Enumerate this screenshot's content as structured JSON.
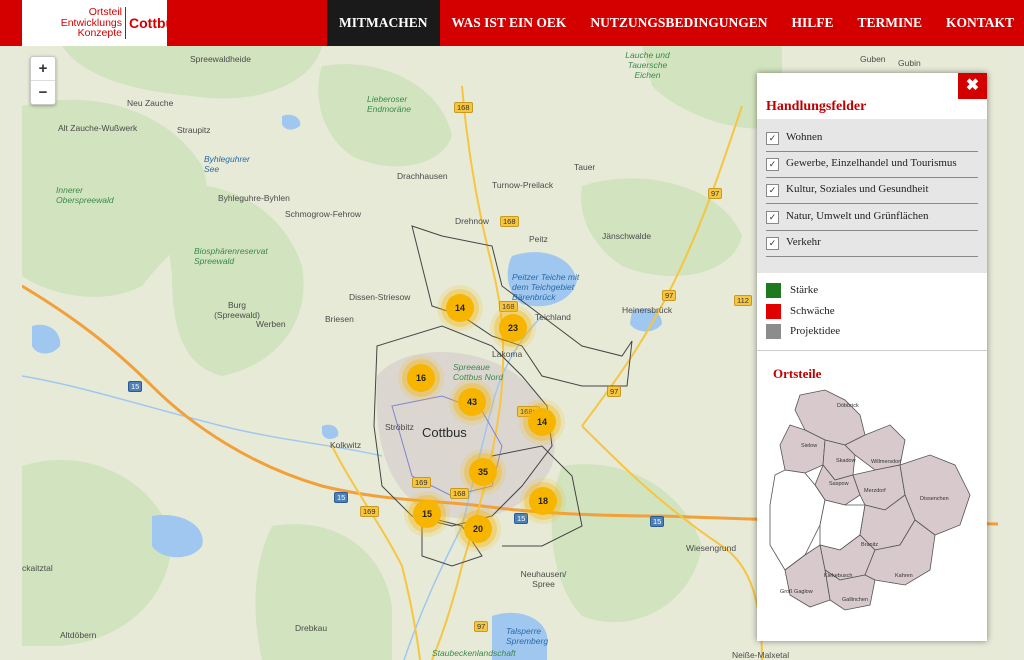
{
  "header": {
    "logo_line1": "Ortsteil",
    "logo_line2": "Entwicklungs",
    "logo_line3": "Konzepte",
    "logo_city": "Cottbus",
    "brand_color": "#d40000",
    "nav": [
      {
        "label": "MITMACHEN",
        "active": true
      },
      {
        "label": "WAS IST EIN OEK",
        "active": false
      },
      {
        "label": "NUTZUNGSBEDINGUNGEN",
        "active": false
      },
      {
        "label": "HILFE",
        "active": false
      },
      {
        "label": "TERMINE",
        "active": false
      },
      {
        "label": "KONTAKT",
        "active": false
      }
    ]
  },
  "map": {
    "zoom_in": "+",
    "zoom_out": "−",
    "places": {
      "spreewaldheide": "Spreewaldheide",
      "neu_zauche": "Neu Zauche",
      "alt_zauche": "Alt Zauche-Wußwerk",
      "straupitz": "Straupitz",
      "byhleguhrer_see": "Byhleguhrer See",
      "byhleguhre": "Byhleguhre-Byhlen",
      "innerer_oberspreewald": "Innerer Oberspreewald",
      "schmogrow": "Schmogrow-Fehrow",
      "drachhausen": "Drachhausen",
      "turnow": "Turnow-Preilack",
      "drehnow": "Drehnow",
      "peitz": "Peitz",
      "tauer": "Tauer",
      "jaenschwalde": "Jänschwalde",
      "lieberoser": "Lieberoser Endmoräne",
      "biosphaere": "Biosphärenreservat Spreewald",
      "burg": "Burg (Spreewald)",
      "dissen": "Dissen-Striesow",
      "werben": "Werben",
      "briesen": "Briesen",
      "peitzer_teiche": "Peitzer Teiche mit dem Teichgebiet Bärenbrück",
      "teichland": "Teichland",
      "heinersbrueck": "Heinersbrück",
      "lakoma": "Lakoma",
      "spreeaue": "Spreeaue Cottbus Nord",
      "stroebitz": "Ströbitz",
      "cottbus": "Cottbus",
      "kolkwitz": "Kolkwitz",
      "wiesengrund": "Wiesengrund",
      "neuhausen": "Neuhausen/ Spree",
      "drebkau": "Drebkau",
      "altdoebern": "Altdöbern",
      "talsperre": "Talsperre Spremberg",
      "guben": "Guben",
      "gubin": "Gubin",
      "lauche": "Lauche und Tauersche Eichen",
      "kaitztal": "ckaitztal",
      "staubecken": "Staubeckenlandschaft",
      "neisse": "Neiße-Malxetal"
    },
    "roads": [
      "168",
      "168",
      "168",
      "168",
      "168n",
      "169",
      "169",
      "15",
      "15",
      "15",
      "15",
      "15",
      "97",
      "97",
      "97",
      "97",
      "112"
    ],
    "clusters": [
      {
        "id": "c1",
        "count": "14"
      },
      {
        "id": "c2",
        "count": "23"
      },
      {
        "id": "c3",
        "count": "16"
      },
      {
        "id": "c4",
        "count": "43"
      },
      {
        "id": "c5",
        "count": "14"
      },
      {
        "id": "c6",
        "count": "35"
      },
      {
        "id": "c7",
        "count": "18"
      },
      {
        "id": "c8",
        "count": "15"
      },
      {
        "id": "c9",
        "count": "20"
      }
    ]
  },
  "panel": {
    "close_icon": "✖",
    "title": "Handlungsfelder",
    "filters": [
      {
        "label": "Wohnen",
        "checked": true
      },
      {
        "label": "Gewerbe, Einzelhandel und Tourismus",
        "checked": true
      },
      {
        "label": "Kultur, Soziales und Gesundheit",
        "checked": true
      },
      {
        "label": "Natur, Umwelt und Grünflächen",
        "checked": true
      },
      {
        "label": "Verkehr",
        "checked": true
      }
    ],
    "check_mark": "✓",
    "legend": [
      {
        "label": "Stärke",
        "color": "#1e7a1e"
      },
      {
        "label": "Schwäche",
        "color": "#e00000"
      },
      {
        "label": "Projektidee",
        "color": "#8c8c8c"
      }
    ],
    "ortsteile_title": "Ortsteile",
    "districts": {
      "doebbrick": "Döbbrick",
      "sielow": "Sielow",
      "skadow": "Skadow",
      "willmersdorf": "Willmersdorf",
      "saspow": "Saspow",
      "merzdorf": "Merzdorf",
      "dissenchen": "Dissenchen",
      "branitz": "Branitz",
      "kiekebusch": "Kiekebusch",
      "kahren": "Kahren",
      "gallinchen": "Gallinchen",
      "gross_gaglow": "Groß Gaglow"
    }
  }
}
